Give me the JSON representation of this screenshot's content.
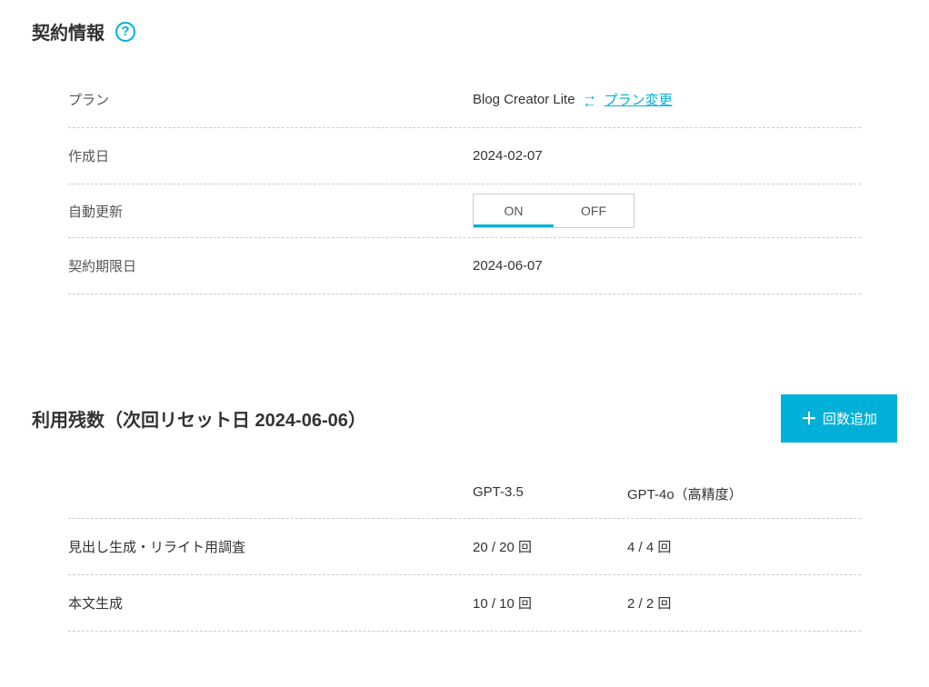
{
  "contract": {
    "section_title": "契約情報",
    "help_icon": "?",
    "rows": {
      "plan": {
        "label": "プラン",
        "value": "Blog Creator Lite",
        "change_link": "プラン変更"
      },
      "created": {
        "label": "作成日",
        "value": "2024-02-07"
      },
      "auto_renew": {
        "label": "自動更新",
        "on": "ON",
        "off": "OFF",
        "active": "on"
      },
      "expiry": {
        "label": "契約期限日",
        "value": "2024-06-07"
      }
    }
  },
  "usage": {
    "section_title": "利用残数（次回リセット日 2024-06-06）",
    "add_button": "回数追加",
    "columns": {
      "col2": "GPT-3.5",
      "col3": "GPT-4o（高精度）"
    },
    "rows": [
      {
        "label": "見出し生成・リライト用調査",
        "gpt35": "20 / 20 回",
        "gpt4o": "4 / 4 回"
      },
      {
        "label": "本文生成",
        "gpt35": "10 / 10 回",
        "gpt4o": "2 / 2 回"
      }
    ]
  }
}
